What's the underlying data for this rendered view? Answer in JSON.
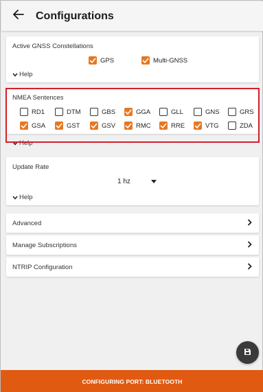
{
  "header": {
    "title": "Configurations",
    "back_icon": "arrow-left-icon"
  },
  "gnss": {
    "title": "Active GNSS Constellations",
    "options": [
      {
        "label": "GPS",
        "checked": true
      },
      {
        "label": "Multi-GNSS",
        "checked": true
      }
    ],
    "help_label": "Help"
  },
  "nmea": {
    "title": "NMEA Sentences",
    "row1": [
      {
        "label": "RD1",
        "checked": false
      },
      {
        "label": "DTM",
        "checked": false
      },
      {
        "label": "GBS",
        "checked": false
      },
      {
        "label": "GGA",
        "checked": true
      },
      {
        "label": "GLL",
        "checked": false
      },
      {
        "label": "GNS",
        "checked": false
      },
      {
        "label": "GRS",
        "checked": false
      }
    ],
    "row2": [
      {
        "label": "GSA",
        "checked": true
      },
      {
        "label": "GST",
        "checked": true
      },
      {
        "label": "GSV",
        "checked": true
      },
      {
        "label": "RMC",
        "checked": true
      },
      {
        "label": "RRE",
        "checked": true
      },
      {
        "label": "VTG",
        "checked": true
      },
      {
        "label": "ZDA",
        "checked": false
      }
    ],
    "help_label": "Help"
  },
  "update_rate": {
    "title": "Update Rate",
    "value": "1 hz",
    "help_label": "Help"
  },
  "sections": [
    {
      "label": "Advanced"
    },
    {
      "label": "Manage Subscriptions"
    },
    {
      "label": "NTRIP Configuration"
    }
  ],
  "fab": {
    "icon": "save-icon"
  },
  "footer": {
    "text": "CONFIGURING PORT: BLUETOOTH"
  },
  "colors": {
    "accent": "#e87722",
    "footer": "#e05a12",
    "highlight": "#d11f2a",
    "fab": "#3a3a3a"
  }
}
